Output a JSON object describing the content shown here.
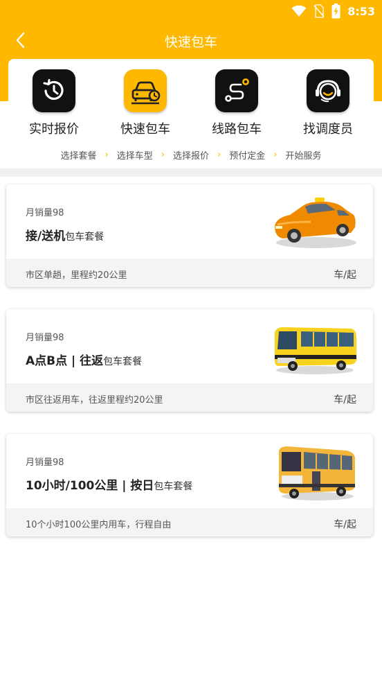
{
  "status_bar": {
    "time": "8:53",
    "icons": [
      "wifi-icon",
      "no-sim-icon",
      "battery-charging-icon"
    ]
  },
  "header": {
    "title": "快速包车",
    "back_icon": "chevron-left-icon"
  },
  "colors": {
    "accent": "#FFB800",
    "icon_dark": "#111111",
    "divider": "#F0F0F0"
  },
  "categories": [
    {
      "label": "实时报价",
      "icon": "clock-history-icon",
      "active": false
    },
    {
      "label": "快速包车",
      "icon": "car-clock-icon",
      "active": true
    },
    {
      "label": "线路包车",
      "icon": "route-icon",
      "active": false
    },
    {
      "label": "找调度员",
      "icon": "headset-agent-icon",
      "active": false
    }
  ],
  "steps": [
    "选择套餐",
    "选择车型",
    "选择报价",
    "预付定金",
    "开始服务"
  ],
  "packages": [
    {
      "sales": "月销量98",
      "title": "接/送机",
      "subtitle": "包车套餐",
      "description": "市区单趟，里程约20公里",
      "price_unit": "车/起",
      "image": "orange-taxi-car-image"
    },
    {
      "sales": "月销量98",
      "title": "A点B点 | 往返",
      "subtitle": "包车套餐",
      "description": "市区往返用车，往返里程约20公里",
      "price_unit": "车/起",
      "image": "yellow-bus-image"
    },
    {
      "sales": "月销量98",
      "title": "10小时/100公里 | 按日",
      "subtitle": "包车套餐",
      "description": "10个小时100公里内用车，行程自由",
      "price_unit": "车/起",
      "image": "city-bus-image"
    }
  ]
}
